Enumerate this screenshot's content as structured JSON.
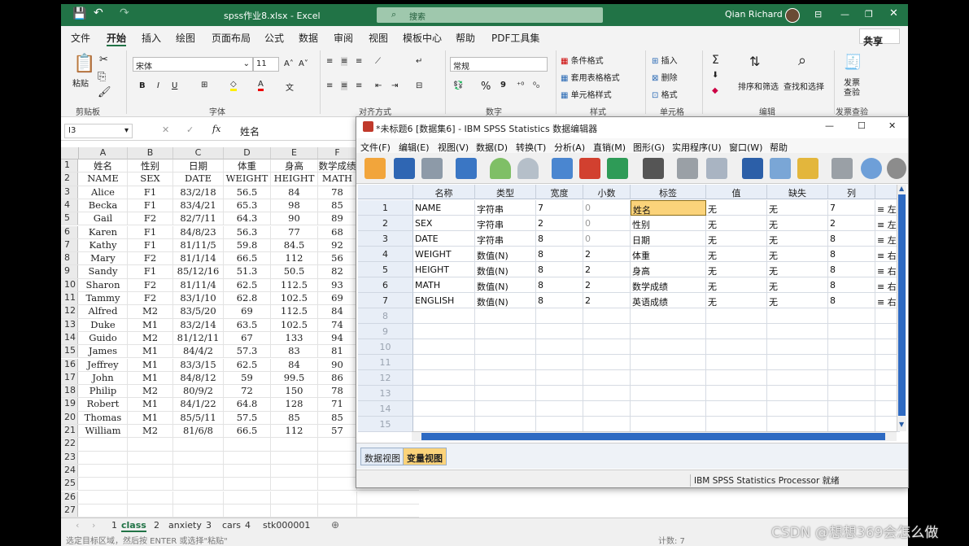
{
  "excel": {
    "title": "spss作业8.xlsx  -  Excel",
    "search": "搜索",
    "user": "Qian Richard",
    "tabs": [
      "文件",
      "开始",
      "插入",
      "绘图",
      "页面布局",
      "公式",
      "数据",
      "审阅",
      "视图",
      "模板中心",
      "帮助",
      "PDF工具集"
    ],
    "share": "共享",
    "ribbon": {
      "paste": "粘贴",
      "font_name": "宋体",
      "font_size": "11",
      "number_format": "常规",
      "cond_format": "条件格式",
      "table_format": "套用表格格式",
      "cell_style": "单元格样式",
      "insert": "插入",
      "delete": "删除",
      "format": "格式",
      "sort_filter": "排序和筛选",
      "find_select": "查找和选择",
      "invoice_check": "发票\n查验",
      "groups": [
        "剪贴板",
        "字体",
        "对齐方式",
        "数字",
        "样式",
        "单元格",
        "编辑",
        "发票查验"
      ]
    },
    "name_box": "I3",
    "formula_value": "姓名",
    "columns": [
      "A",
      "B",
      "C",
      "D",
      "E",
      "F"
    ],
    "rows": [
      [
        "姓名",
        "性别",
        "日期",
        "体重",
        "身高",
        "数学成绩"
      ],
      [
        "NAME",
        "SEX",
        "DATE",
        "WEIGHT",
        "HEIGHT",
        "MATH"
      ],
      [
        "Alice",
        "F1",
        "83/2/18",
        "56.5",
        "84",
        "78"
      ],
      [
        "Becka",
        "F1",
        "83/4/21",
        "65.3",
        "98",
        "85"
      ],
      [
        "Gail",
        "F2",
        "82/7/11",
        "64.3",
        "90",
        "89"
      ],
      [
        "Karen",
        "F1",
        "84/8/23",
        "56.3",
        "77",
        "68"
      ],
      [
        "Kathy",
        "F1",
        "81/11/5",
        "59.8",
        "84.5",
        "92"
      ],
      [
        "Mary",
        "F2",
        "81/1/14",
        "66.5",
        "112",
        "56"
      ],
      [
        "Sandy",
        "F1",
        "85/12/16",
        "51.3",
        "50.5",
        "82"
      ],
      [
        "Sharon",
        "F2",
        "81/11/4",
        "62.5",
        "112.5",
        "93"
      ],
      [
        "Tammy",
        "F2",
        "83/1/10",
        "62.8",
        "102.5",
        "69"
      ],
      [
        "Alfred",
        "M2",
        "83/5/20",
        "69",
        "112.5",
        "84"
      ],
      [
        "Duke",
        "M1",
        "83/2/14",
        "63.5",
        "102.5",
        "74"
      ],
      [
        "Guido",
        "M2",
        "81/12/11",
        "67",
        "133",
        "94"
      ],
      [
        "James",
        "M1",
        "84/4/2",
        "57.3",
        "83",
        "81"
      ],
      [
        "Jeffrey",
        "M1",
        "83/3/15",
        "62.5",
        "84",
        "90"
      ],
      [
        "John",
        "M1",
        "84/8/12",
        "59",
        "99.5",
        "86"
      ],
      [
        "Philip",
        "M2",
        "80/9/2",
        "72",
        "150",
        "78"
      ],
      [
        "Robert",
        "M1",
        "84/1/22",
        "64.8",
        "128",
        "71"
      ],
      [
        "Thomas",
        "M1",
        "85/5/11",
        "57.5",
        "85",
        "85"
      ],
      [
        "William",
        "M2",
        "81/6/8",
        "66.5",
        "112",
        "57"
      ],
      [
        "",
        "",
        "",
        "",
        "",
        ""
      ],
      [
        "",
        "",
        "",
        "",
        "",
        ""
      ],
      [
        "",
        "",
        "",
        "",
        "",
        ""
      ],
      [
        "",
        "",
        "",
        "",
        "",
        ""
      ],
      [
        "",
        "",
        "",
        "",
        "",
        ""
      ],
      [
        "",
        "",
        "",
        "",
        "",
        ""
      ]
    ],
    "sheets": [
      {
        "index": "1",
        "name": "class"
      },
      {
        "index": "2",
        "name": "anxiety"
      },
      {
        "index": "3",
        "name": "cars"
      },
      {
        "index": "4",
        "name": "stk000001"
      }
    ],
    "status_left": "选定目标区域，然后按 ENTER 或选择\"粘贴\"",
    "status_count": "计数: 7"
  },
  "spss": {
    "title": "*未标题6 [数据集6] - IBM SPSS Statistics 数据编辑器",
    "menu": [
      "文件(F)",
      "编辑(E)",
      "视图(V)",
      "数据(D)",
      "转换(T)",
      "分析(A)",
      "直销(M)",
      "图形(G)",
      "实用程序(U)",
      "窗口(W)",
      "帮助"
    ],
    "headers": [
      "名称",
      "类型",
      "宽度",
      "小数",
      "标签",
      "值",
      "缺失",
      "列"
    ],
    "variables": [
      {
        "n": "1",
        "name": "NAME",
        "type": "字符串",
        "width": "7",
        "dec": "0",
        "label": "姓名",
        "values": "无",
        "missing": "无",
        "cols": "7",
        "align": "左"
      },
      {
        "n": "2",
        "name": "SEX",
        "type": "字符串",
        "width": "2",
        "dec": "0",
        "label": "性别",
        "values": "无",
        "missing": "无",
        "cols": "2",
        "align": "左"
      },
      {
        "n": "3",
        "name": "DATE",
        "type": "字符串",
        "width": "8",
        "dec": "0",
        "label": "日期",
        "values": "无",
        "missing": "无",
        "cols": "8",
        "align": "左"
      },
      {
        "n": "4",
        "name": "WEIGHT",
        "type": "数值(N)",
        "width": "8",
        "dec": "2",
        "label": "体重",
        "values": "无",
        "missing": "无",
        "cols": "8",
        "align": "右"
      },
      {
        "n": "5",
        "name": "HEIGHT",
        "type": "数值(N)",
        "width": "8",
        "dec": "2",
        "label": "身高",
        "values": "无",
        "missing": "无",
        "cols": "8",
        "align": "右"
      },
      {
        "n": "6",
        "name": "MATH",
        "type": "数值(N)",
        "width": "8",
        "dec": "2",
        "label": "数学成绩",
        "values": "无",
        "missing": "无",
        "cols": "8",
        "align": "右"
      },
      {
        "n": "7",
        "name": "ENGLISH",
        "type": "数值(N)",
        "width": "8",
        "dec": "2",
        "label": "英语成绩",
        "values": "无",
        "missing": "无",
        "cols": "8",
        "align": "右"
      }
    ],
    "empty_rows": [
      "8",
      "9",
      "10",
      "11",
      "12",
      "13",
      "14",
      "15"
    ],
    "view_tabs": [
      "数据视图",
      "变量视图"
    ],
    "status": "IBM SPSS Statistics Processor 就绪"
  },
  "watermark": "CSDN @想想369会怎么做"
}
